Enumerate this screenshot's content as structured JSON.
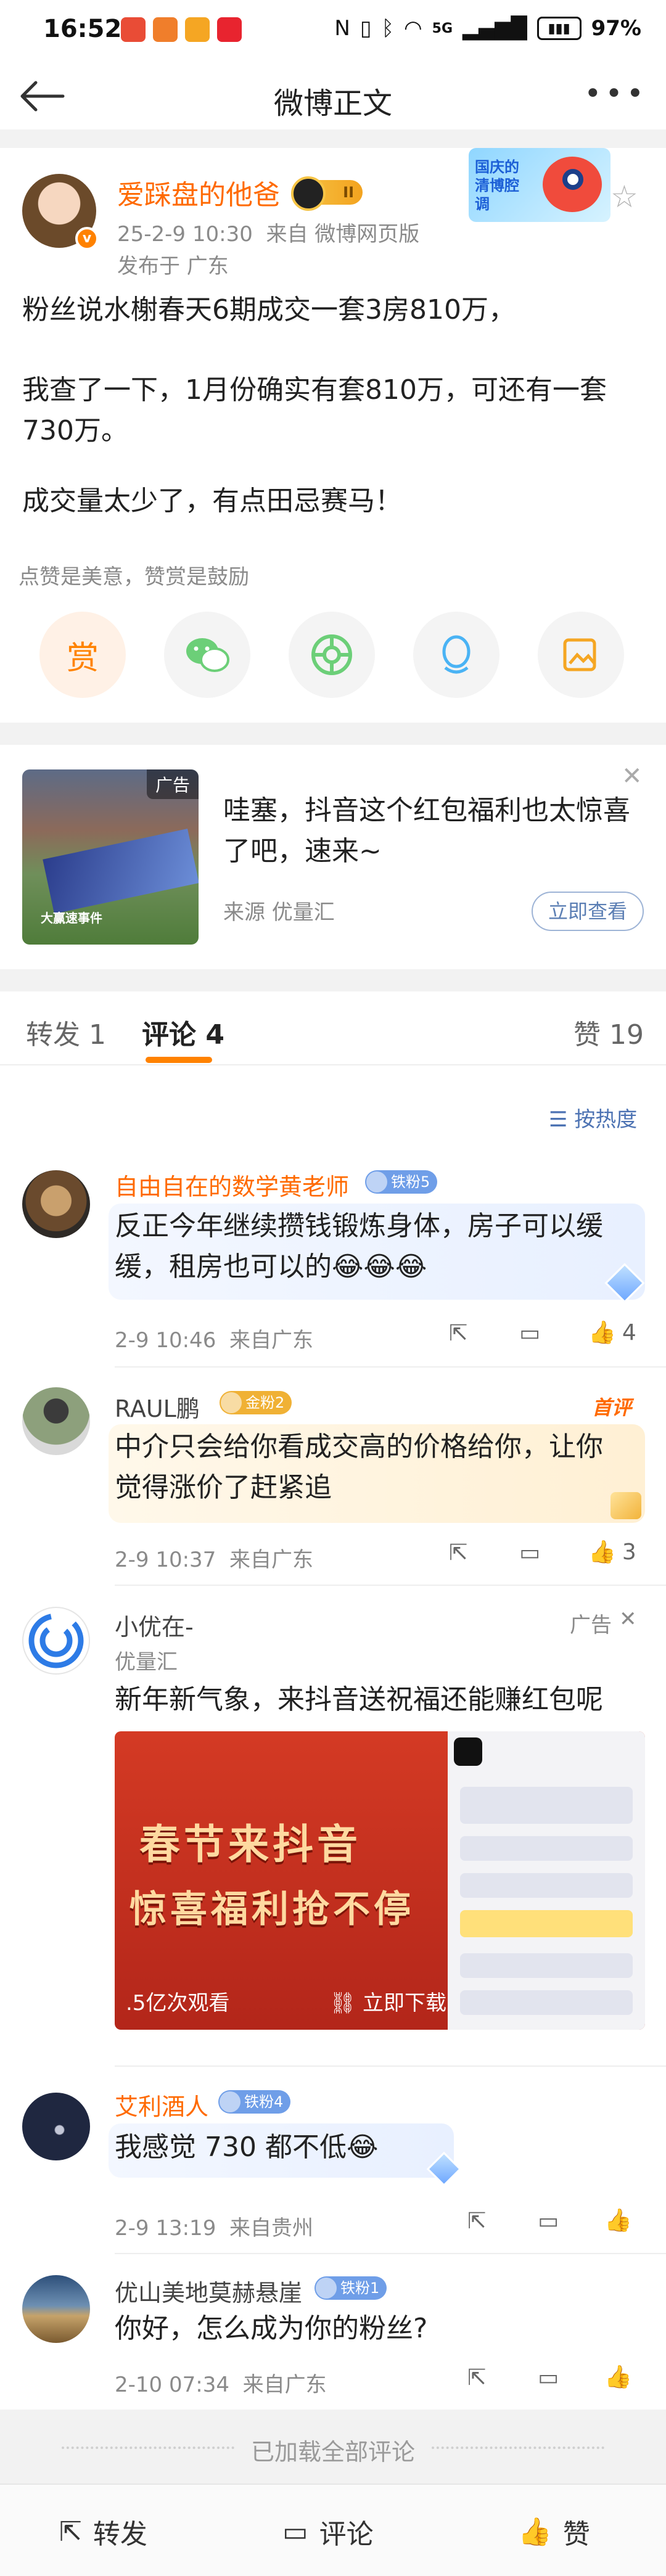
{
  "status_bar": {
    "time": "16:52",
    "network": "5G",
    "battery": "97%"
  },
  "nav": {
    "title": "微博正文"
  },
  "post": {
    "author": "爱踩盘的他爸",
    "level_badge": "II",
    "time": "25-2-9 10:30",
    "source": "来自 微博网页版",
    "location": "发布于 广东",
    "paragraphs": [
      "粉丝说水榭春天6期成交一套3房810万，",
      "我查了一下，1月份确实有套810万，可还有一套730万。",
      "成交量太少了，有点田忌赛马！"
    ],
    "reward_hint": "点赞是美意，赞赏是鼓励",
    "reward_label": "赏",
    "promo_text": "国庆的清博腔调"
  },
  "ad": {
    "tag": "广告",
    "image_caption": "大赢速事件",
    "text": "哇塞，抖音这个红包福利也太惊喜了吧，速来~",
    "source": "来源 优量汇",
    "button": "立即查看"
  },
  "tabs": {
    "repost": "转发 1",
    "comment": "评论 4",
    "like": "赞 19"
  },
  "sort_label": "按热度",
  "comments": [
    {
      "name": "自由自在的数学黄老师",
      "fan_badge": "铁粉5",
      "text": "反正今年继续攒钱锻炼身体，房子可以缓缓，租房也可以的😂😂😂",
      "time": "2-9 10:46",
      "location": "来自广东",
      "likes": "4"
    },
    {
      "name": "RAUL鹏",
      "fan_badge": "金粉2",
      "tag": "首评",
      "text": "中介只会给你看成交高的价格给你，让你觉得涨价了赶紧追",
      "time": "2-9 10:37",
      "location": "来自广东",
      "likes": "3"
    },
    {
      "name": "艾利酒人",
      "fan_badge": "铁粉4",
      "text": "我感觉 730 都不低😂",
      "time": "2-9 13:19",
      "location": "来自贵州"
    },
    {
      "name": "优山美地莫赫悬崖",
      "fan_badge": "铁粉1",
      "text": "你好，怎么成为你的粉丝?",
      "time": "2-10 07:34",
      "location": "来自广东"
    }
  ],
  "ad_comment": {
    "name": "小优在-",
    "sub": "优量汇",
    "tag": "广告",
    "text": "新年新气象，来抖音送祝福还能赚红包呢",
    "banner_line1": "春节来抖音",
    "banner_line2": "惊喜福利抢不停",
    "views": ".5亿次观看",
    "download": "立即下载"
  },
  "loaded_all": "已加载全部评论",
  "bottom_bar": {
    "repost": "转发",
    "comment": "评论",
    "like": "赞"
  },
  "colors": {
    "accent": "#ff8200",
    "name_orange": "#ff6a00",
    "link_blue": "#4d73b3"
  }
}
